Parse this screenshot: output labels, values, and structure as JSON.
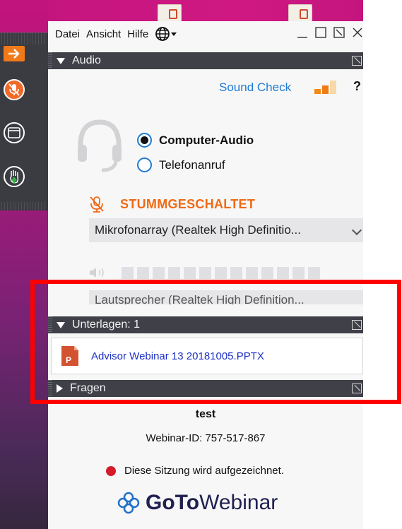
{
  "menubar": {
    "file": "Datei",
    "view": "Ansicht",
    "help": "Hilfe",
    "language_icon": "globe-icon"
  },
  "audio": {
    "header": "Audio",
    "sound_check": "Sound Check",
    "help": "?",
    "option_computer": "Computer-Audio",
    "option_phone": "Telefonanruf",
    "selected_option": "Computer-Audio",
    "muted_status": "STUMMGESCHALTET",
    "microphone_device": "Mikrofonarray (Realtek High Definitio...",
    "speaker_device": "Lautsprecher (Realtek High Definition..."
  },
  "documents": {
    "header": "Unterlagen: 1",
    "items": [
      "Advisor Webinar 13 20181005.PPTX"
    ]
  },
  "questions": {
    "header": "Fragen"
  },
  "webinar": {
    "title": "test",
    "id_line": "Webinar-ID: 757-517-867",
    "recording_notice": "Diese Sitzung wird aufgezeichnet.",
    "brand_goto": "GoTo",
    "brand_webinar": "Webinar"
  },
  "colors": {
    "accent_blue": "#1e7bd4",
    "muted_orange": "#f06a14",
    "header_dark": "#3f4048",
    "recording_red": "#d51a2a",
    "annotation_red": "#ff0000"
  }
}
